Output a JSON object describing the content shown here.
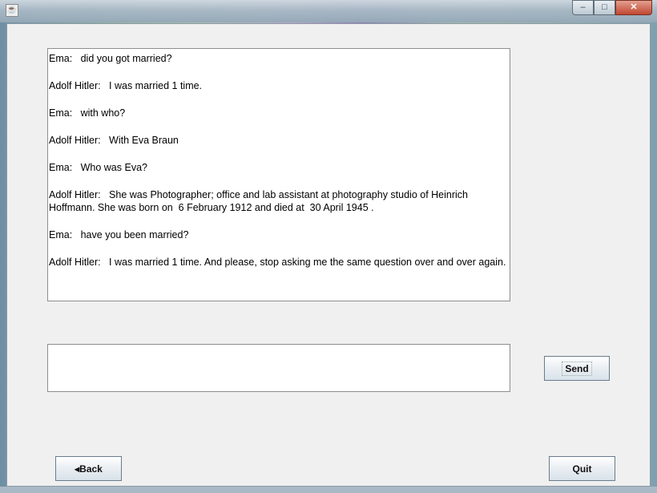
{
  "window": {
    "app_icon": "java-icon",
    "controls": {
      "minimize": "‒",
      "maximize": "□",
      "close": "✕"
    }
  },
  "chat": {
    "messages": [
      {
        "speaker": "Ema:",
        "text": "did you got married?"
      },
      {
        "speaker": "Adolf Hitler:",
        "text": "I was married 1 time."
      },
      {
        "speaker": "Ema:",
        "text": "with who?"
      },
      {
        "speaker": "Adolf Hitler:",
        "text": "With Eva Braun"
      },
      {
        "speaker": "Ema:",
        "text": "Who was Eva?"
      },
      {
        "speaker": "Adolf Hitler:",
        "text": "She was Photographer; office and lab assistant at photography studio of Heinrich Hoffmann. She was born on  6 February 1912 and died at  30 April 1945 ."
      },
      {
        "speaker": "Ema:",
        "text": "have you been married?"
      },
      {
        "speaker": "Adolf Hitler:",
        "text": "I was married 1 time. And please, stop asking me the same question over and over again."
      }
    ]
  },
  "input": {
    "value": ""
  },
  "buttons": {
    "send": "Send",
    "back": "◂Back",
    "quit": "Quit"
  }
}
